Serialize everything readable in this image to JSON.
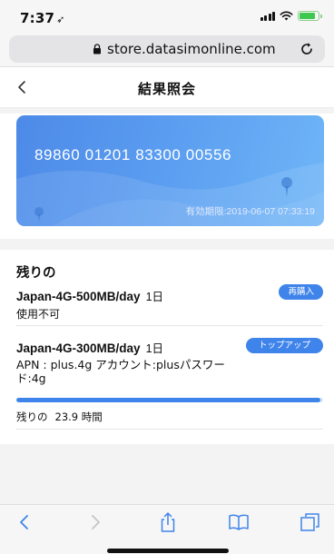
{
  "status_bar": {
    "time": "7:37",
    "time_icon": "location-arrow-icon"
  },
  "browser": {
    "url": "store.datasimonline.com"
  },
  "header": {
    "title": "結果照会",
    "back_icon": "chevron-left-icon"
  },
  "card": {
    "number": "89860 01201 83300 00556",
    "expiry": "有効期限:2019-06-07 07:33:19"
  },
  "remaining_section": {
    "title": "残りの",
    "plans": [
      {
        "name": "Japan-4G-500MB/day",
        "days": "1日",
        "status": "使用不可",
        "button": "再購入"
      },
      {
        "name": "Japan-4G-300MB/day",
        "days": "1日",
        "apn": "APN : plus.4g アカウント:plusパスワード:4g",
        "button": "トップアップ",
        "progress_fraction": 0.99,
        "remaining_label": "残りの",
        "remaining_value": "23.9 時間"
      }
    ]
  },
  "colors": {
    "accent": "#3f84ea",
    "card_start": "#4d8ae8",
    "card_end": "#6fb6f7"
  },
  "toolbar_icons": [
    "back-arrow-icon",
    "forward-arrow-icon",
    "share-icon",
    "bookmarks-icon",
    "tabs-icon"
  ]
}
